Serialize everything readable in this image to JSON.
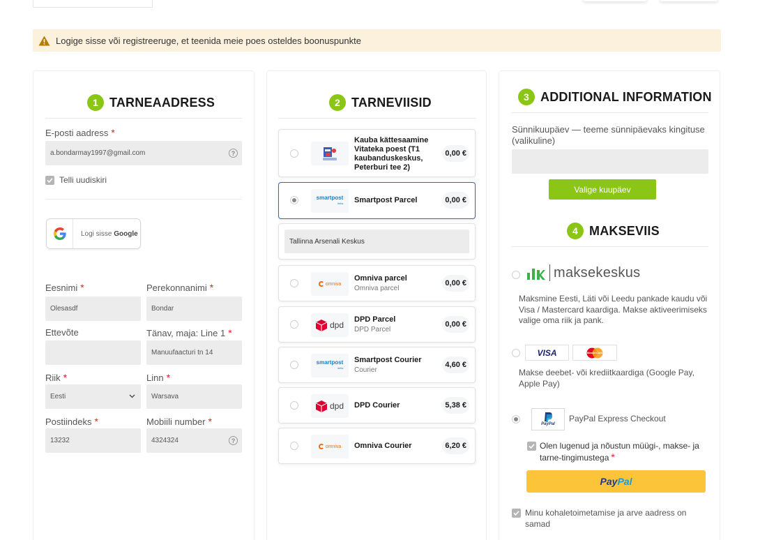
{
  "notice": {
    "text": "Logige sisse või registreeruge, et teenida meie poes osteldes boonuspunkte"
  },
  "address": {
    "step": "1",
    "title": "TARNEAADRESS",
    "email_label": "E-posti aadress",
    "email_value": "a.bondarmay1997@gmail.com",
    "newsletter_label": "Telli uudiskiri",
    "google_text": "Logi sisse",
    "google_brand": "Google",
    "first_name_label": "Eesnimi",
    "first_name_value": "Olesasdf",
    "last_name_label": "Perekonnanimi",
    "last_name_value": "Bondar",
    "company_label": "Ettevõte",
    "company_value": "",
    "street_label": "Tänav, maja: Line 1",
    "street_value": "Manuufaacturi tn 14",
    "country_label": "Riik",
    "country_value": "Eesti",
    "city_label": "Linn",
    "city_value": "Warsava",
    "postal_label": "Postiindeks",
    "postal_value": "13232",
    "phone_label": "Mobiili number",
    "phone_value": "4324324",
    "required_mark": "*",
    "help_mark": "?"
  },
  "shipping": {
    "step": "2",
    "title": "TARNEVIISID",
    "methods": [
      {
        "name": "Kauba kättesaamine Vitateka poest (T1 kaubanduskeskus, Peterburi tee 2)",
        "sub": "",
        "price": "0,00 €",
        "logo": "store-icon"
      },
      {
        "name": "Smartpost Parcel",
        "sub": "",
        "price": "0,00 €",
        "logo": "smartpost-logo"
      },
      {
        "name": "Omniva parcel",
        "sub": "Omniva parcel",
        "price": "0,00 €",
        "logo": "omniva-logo"
      },
      {
        "name": "DPD Parcel",
        "sub": "DPD Parcel",
        "price": "0,00 €",
        "logo": "dpd-logo"
      },
      {
        "name": "Smartpost Courier",
        "sub": "Courier",
        "price": "4,60 €",
        "logo": "smartpost-logo"
      },
      {
        "name": "DPD Courier",
        "sub": "",
        "price": "5,38 €",
        "logo": "dpd-logo"
      },
      {
        "name": "Omniva Courier",
        "sub": "",
        "price": "6,20 €",
        "logo": "omniva-logo"
      }
    ],
    "pickup_point": "Tallinna Arsenali Keskus",
    "logo_text": {
      "smartpost": "smartpost",
      "smartpost_sub": "itella",
      "omniva": "omniva",
      "dpd": "dpd"
    }
  },
  "additional": {
    "step": "3",
    "title": "ADDITIONAL INFORMATION",
    "birthday_label": "Sünnikuupäev — teeme sünnipäevaks kingituse (valikuline)",
    "birthday_value": "",
    "date_button": "Valige kuupäev"
  },
  "payment": {
    "step": "4",
    "title": "MAKSEVIIS",
    "maksekeskus_brand": "maksekeskus",
    "maksekeskus_desc": "Maksmine Eesti, Läti või Leedu pankade kaudu või Visa / Mastercard kaardiga. Makse aktiveerimiseks valige oma riik ja pank.",
    "visa_text": "VISA",
    "mastercard_text": "MasterCard",
    "card_desc": "Makse deebet- või krediitkaardiga (Google Pay, Apple Pay)",
    "paypal_label": "PayPal Express Checkout",
    "paypal_logo_text": "PayPal",
    "terms_label": "Olen lugenud ja nõustun müügi-, makse- ja tarne-tingimustega",
    "paypal_button_1": "Pay",
    "paypal_button_2": "Pal",
    "same_address_label": "Minu kohaletoimetamise ja arve aadress on samad"
  },
  "colors": {
    "accent": "#8bc516",
    "notice_bg": "#fcf1dd",
    "selected_border": "#1e6fc8",
    "paypal_yellow": "#fcc439"
  }
}
